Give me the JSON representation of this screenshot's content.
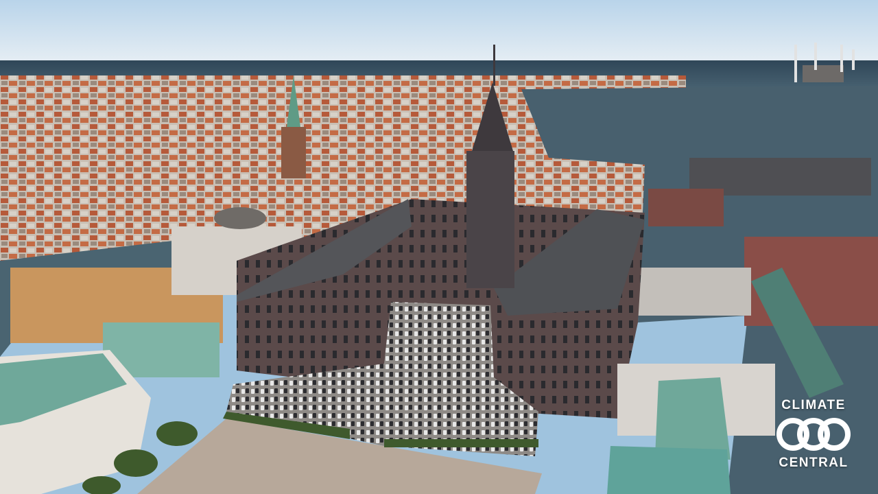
{
  "logo": {
    "line1": "CLIMATE",
    "line2": "CENTRAL",
    "mark": "co2-icon"
  },
  "colors": {
    "sky_top": "#b9d4ea",
    "sky_bottom": "#e6eef4",
    "sea": "#3d5565",
    "flood_water": "#48606e",
    "roof_red": "#b65a3a",
    "roof_slate": "#4e5155",
    "roof_copper": "#6fa89a",
    "facade_brick": "#5b4a4a",
    "courtyard": "#b7a89a",
    "logo_white": "#ffffff"
  }
}
